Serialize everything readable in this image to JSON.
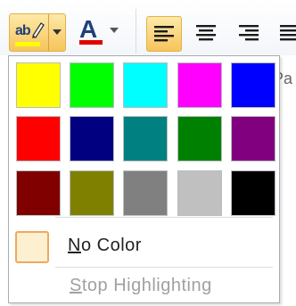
{
  "toolbar": {
    "highlight_icon_text": "ab",
    "font_color_glyph": "A",
    "paragraph_peek": "Pa"
  },
  "icons": {
    "highlighter": "highlighter-pen-icon",
    "dropdown": "chevron-down-icon",
    "font_color": "font-color-icon",
    "align_left": "align-left-icon",
    "align_center": "align-center-icon",
    "align_right": "align-right-icon"
  },
  "colors": {
    "current_highlight": "#ffff00",
    "current_font_color": "#e10000",
    "accent_border": "#e3b24a"
  },
  "palette": [
    [
      "#ffff00",
      "#00ff00",
      "#00ffff",
      "#ff00ff",
      "#0000ff"
    ],
    [
      "#ff0000",
      "#000080",
      "#008080",
      "#008000",
      "#800080"
    ],
    [
      "#800000",
      "#808000",
      "#808080",
      "#c0c0c0",
      "#000000"
    ]
  ],
  "menu": {
    "no_color_first": "N",
    "no_color_rest": "o Color",
    "stop_first": "S",
    "stop_rest": "top Highlighting"
  }
}
